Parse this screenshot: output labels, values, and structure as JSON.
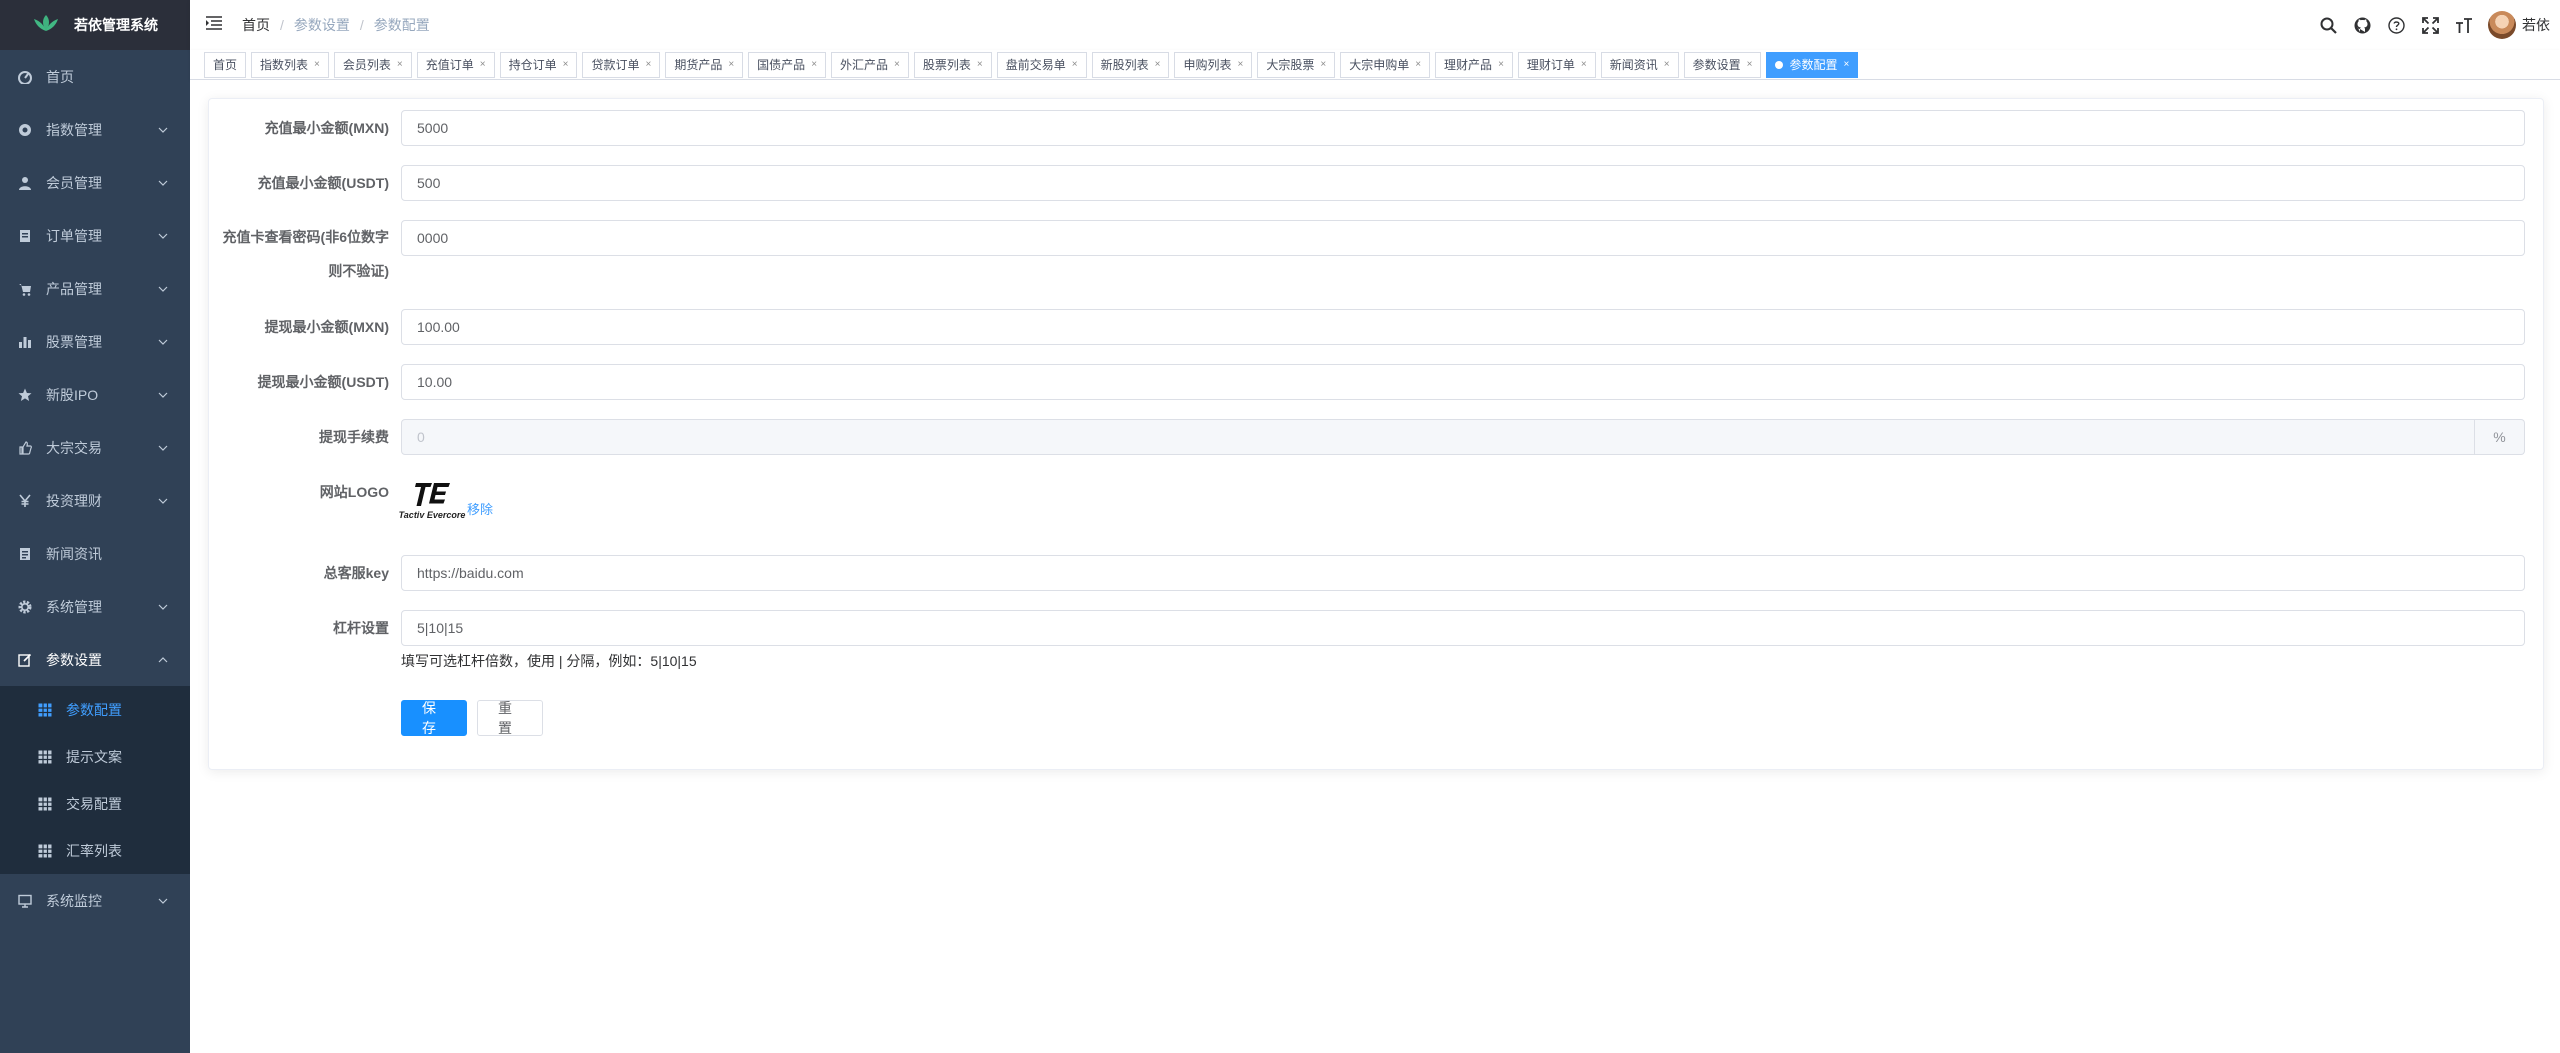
{
  "app": {
    "title": "若依管理系统"
  },
  "sidebar": {
    "items": [
      {
        "label": "首页",
        "icon": "dashboard-icon"
      },
      {
        "label": "指数管理",
        "icon": "index-icon"
      },
      {
        "label": "会员管理",
        "icon": "user-icon"
      },
      {
        "label": "订单管理",
        "icon": "order-icon"
      },
      {
        "label": "产品管理",
        "icon": "cart-icon"
      },
      {
        "label": "股票管理",
        "icon": "chart-icon"
      },
      {
        "label": "新股IPO",
        "icon": "star-icon"
      },
      {
        "label": "大宗交易",
        "icon": "thumb-icon"
      },
      {
        "label": "投资理财",
        "icon": "yen-icon"
      },
      {
        "label": "新闻资讯",
        "icon": "news-icon"
      },
      {
        "label": "系统管理",
        "icon": "gear-icon"
      },
      {
        "label": "参数设置",
        "icon": "edit-icon"
      }
    ],
    "sub_items": [
      {
        "label": "参数配置"
      },
      {
        "label": "提示文案"
      },
      {
        "label": "交易配置"
      },
      {
        "label": "汇率列表"
      }
    ],
    "monitor": {
      "label": "系统监控",
      "icon": "monitor-icon"
    }
  },
  "breadcrumb": {
    "home": "首页",
    "parent": "参数设置",
    "current": "参数配置"
  },
  "user": {
    "name": "若依"
  },
  "tags": [
    "首页",
    "指数列表",
    "会员列表",
    "充值订单",
    "持仓订单",
    "贷款订单",
    "期货产品",
    "国债产品",
    "外汇产品",
    "股票列表",
    "盘前交易单",
    "新股列表",
    "申购列表",
    "大宗股票",
    "大宗申购单",
    "理财产品",
    "理财订单",
    "新闻资讯",
    "参数设置",
    "参数配置"
  ],
  "form": {
    "recharge_min_mxn": {
      "label": "充值最小金额(MXN)",
      "value": "5000"
    },
    "recharge_min_usdt": {
      "label": "充值最小金额(USDT)",
      "value": "500"
    },
    "card_password": {
      "label_line1": "充值卡查看密码(非6位数字",
      "label_line2": "则不验证)",
      "value": "0000"
    },
    "withdraw_min_mxn": {
      "label": "提现最小金额(MXN)",
      "value": "100.00"
    },
    "withdraw_min_usdt": {
      "label": "提现最小金额(USDT)",
      "value": "10.00"
    },
    "withdraw_fee": {
      "label": "提现手续费",
      "placeholder": "0",
      "append": "%"
    },
    "site_logo": {
      "label": "网站LOGO",
      "caption": "Tactiv Evercore",
      "remove": "移除"
    },
    "service_key": {
      "label": "总客服key",
      "value": "https://baidu.com"
    },
    "leverage": {
      "label": "杠杆设置",
      "value": "5|10|15",
      "hint": "填写可选杠杆倍数，使用 | 分隔，例如：5|10|15"
    },
    "buttons": {
      "save": "保存",
      "reset": "重置"
    }
  },
  "colors": {
    "sidebar_bg": "#304156",
    "submenu_bg": "#1f2d3d",
    "accent": "#409eff",
    "primary_button": "#1890ff"
  }
}
